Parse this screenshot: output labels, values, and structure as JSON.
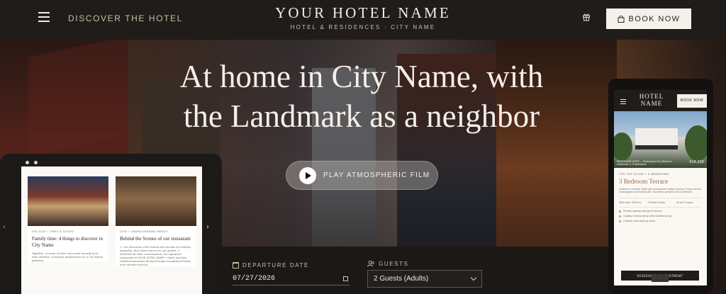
{
  "header": {
    "nav_label": "DISCOVER THE HOTEL",
    "brand_name": "YOUR HOTEL NAME",
    "brand_sub": "HOTEL & RESIDENCES · CITY NAME",
    "book_label": "BOOK NOW"
  },
  "hero": {
    "title_line1": "At home in City Name, with",
    "title_line2": "the Landmark as a neighbor",
    "play_label": "PLAY ATMOSPHERIC FILM"
  },
  "booking": {
    "departure_label": "DEPARTURE DATE",
    "departure_value": "07/27/2026",
    "guests_label": "GUESTS",
    "guests_value": "2 Guests (Adults)"
  },
  "tablet": {
    "cards": [
      {
        "meta": "JUN 2026 • TIMES & GUIDES",
        "title": "Family time: 4 things to discover in City Name",
        "body": "Together, unravel all their own pace according to their abilities. A dreamy perspective for a City Name getaway."
      },
      {
        "meta": "2026 • AWARD-WINNING MENUS",
        "title": "Behind the Scenes of our restaurant",
        "body": "1. Our executive chef reveals the secrets of creating exquisite, first-class menus for our guests. 2. Selected for their connoisseurs, our signature restaurant of YOUR HOTEL NAME • Hotel and Spa redefines boutique dining through exceptional flavor and intimate service."
      }
    ]
  },
  "phone": {
    "brand_name": "HOTEL NAME",
    "brand_sub": "HOTEL & RESIDENCES · CITY",
    "book_label": "BOOK NOW",
    "image_caption": "PENTHOUSE SUITE — Penthouse City Name & Landmark 2-3 bedrooms",
    "price": "€14,200",
    "meta": "7TH TOP FLOOR • 3 BEDROOMS",
    "title": "3 Bedroom Terrace",
    "desc": "Features a private 3000 sqft landscaped rooftop terrace. Enjoy serene champagne overlooking the Trocadero gardens and Landmark.",
    "specs": [
      "3000 sqft / 3500 ft2",
      "3 Master Suites",
      "Up to 6 Guests"
    ],
    "features": [
      "Private rooftop lounge & terrace",
      "Outdoor dining setup with heated lamps",
      "Custom wine tasting cellar"
    ],
    "cta_label": "RESERVE THIS APARTMENT"
  },
  "colors": {
    "header_bg": "#1f1c19",
    "accent_gold": "#c9bfa8",
    "book_bg": "#f5f0ea"
  }
}
